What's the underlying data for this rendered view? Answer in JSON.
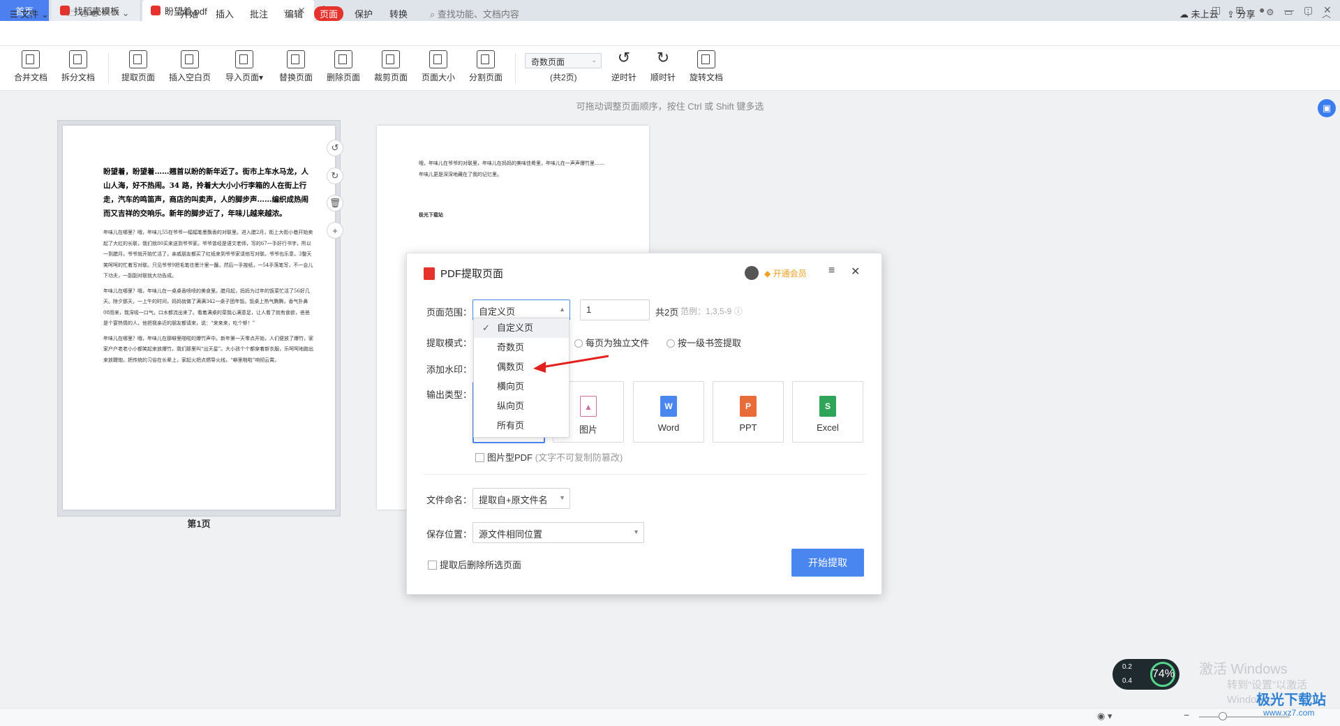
{
  "tabs": {
    "home": "首页",
    "template": "找稻壳模板",
    "document": "盼望着.pdf"
  },
  "menu": {
    "file": "文件",
    "items": [
      "开始",
      "插入",
      "批注",
      "编辑",
      "页面",
      "保护",
      "转换"
    ],
    "search": "查找功能、文档内容",
    "cloud": "未上云",
    "share": "分享"
  },
  "ribbon": {
    "buttons": [
      "合并文档",
      "拆分文档",
      "提取页面",
      "插入空白页",
      "导入页面",
      "替换页面",
      "删除页面",
      "裁剪页面",
      "页面大小",
      "分割页面"
    ],
    "page_filter": "奇数页面",
    "page_count": "(共2页)",
    "rotate": [
      "逆时针",
      "顺时针",
      "旋转文档"
    ]
  },
  "hint": "可拖动调整页面顺序，按住 Ctrl 或 Shift 键多选",
  "page1": {
    "lead": "盼望着，盼望着……翘首以盼的新年近了。街市上车水马龙，人山人海，好不热闹。34 路，拎着大大小小行李箱的人在街上行走，汽车的鸣笛声，商店的叫卖声，人的脚步声……编织成热闹而又吉祥的交响乐。新年的脚步近了，年味儿越来越浓。",
    "p1": "年味儿在哪里？哦，年味儿55在爷爷一幅幅笔墨飘香的对联里。进入腊2月，街上大街小巷开始卖起了大红的长联，我们就80买来送到爷爷家。爷爷曾经是语文老师，写的67一手好行书字，所以一到腊月，爷爷就开始忙活了，亲戚朋友都买了红纸来到爷爷家请他写对联。爷爷也乐意，3整天笑呵呵的忙着写对联。只见爷爷9把毛笔往墨汁里一蘸，然后一手按纸，一54手落笔写，不一会儿下功夫，一副副对联就大功告成。",
    "p2": "年味儿在哪里？哦，年味儿在一桌桌香喷喷的美食里。腊月起，妈妈为过年的饭菜忙活了56好几天。除夕那天，一上午的时间，妈妈就做了满满342一桌子团年饭。饭桌上热气腾腾，香气扑鼻08而来，我深吸一口气，口水都流出来了。看着满桌的菜我心满意足，让人看了就有食欲，爸爸是个宴热情的人，他把我亲近的朋友都请来，说：“来来来，吃个够！”",
    "p3": "年味儿在哪里？哦，年味儿在那噼里啪啦的爆竹声中。新年第一天零点开始，人们便放了爆竹，家家户户老老小小都笑起来放爆竹，我们那里叫“出天星”。大小孩个个都穿着新衣服，乐呵呵地跑出来放鞭炮，把传统的习俗在长辈上，家起火把点燃导火线，“噼里啪啦”响彻云霄。"
  },
  "page1_label": "第1页",
  "page2": {
    "text": "哦，年味儿在爷爷的对联里，年味儿在妈妈的美味佳肴里，年味儿在一声声爆竹里……年味儿更是深深地藏在了我的记忆里。",
    "heading": "极光下载站"
  },
  "dialog": {
    "title": "PDF提取页面",
    "vip": "开通会员",
    "range_label": "页面范围：",
    "range_value": "自定义页",
    "range_input": "1",
    "total": "共2页",
    "example": "范例：1,3,5-9",
    "mode_label": "提取模式：",
    "mode_opt1": "每页为独立文件",
    "mode_opt2": "按一级书签提取",
    "watermark_label": "添加水印：",
    "output_label": "输出类型：",
    "outputs": [
      "图片",
      "Word",
      "PPT",
      "Excel"
    ],
    "image_pdf": "图片型PDF",
    "image_pdf_note": "(文字不可复制防篡改)",
    "naming_label": "文件命名：",
    "naming_value": "提取自+原文件名",
    "save_label": "保存位置：",
    "save_value": "源文件相同位置",
    "delete_after": "提取后删除所选页面",
    "start": "开始提取"
  },
  "dropdown": [
    "自定义页",
    "奇数页",
    "偶数页",
    "横向页",
    "纵向页",
    "所有页"
  ],
  "status": {
    "badge_top": "0.2",
    "badge_bottom": "0.4",
    "percent": "74%",
    "watermark": "激活 Windows",
    "watermark2": "转到“设置”以激活 Windows。",
    "site": "极光下载站",
    "url": "www.xz7.com"
  }
}
